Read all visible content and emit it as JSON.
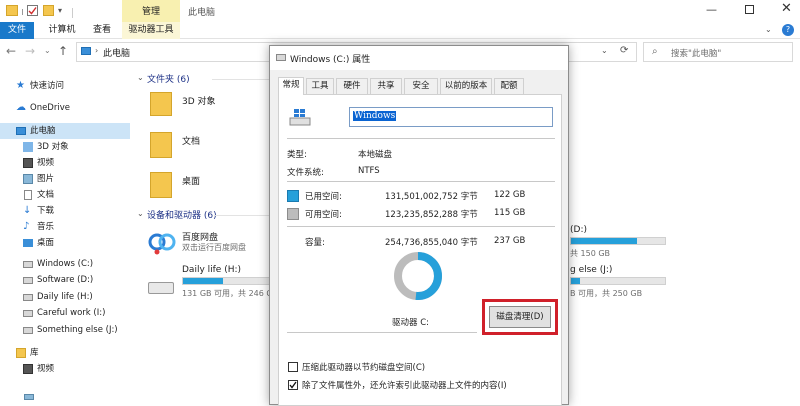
{
  "window": {
    "title": "此电脑",
    "context_tab": "管理",
    "ribbon_tabs": [
      "文件",
      "计算机",
      "查看",
      "驱动器工具"
    ]
  },
  "address": {
    "path": "此电脑",
    "search_placeholder": "搜索\"此电脑\""
  },
  "sidebar": {
    "items": [
      {
        "label": "快速访问",
        "icon": "star-icon"
      },
      {
        "label": "OneDrive",
        "icon": "cloud-icon"
      },
      {
        "label": "此电脑",
        "icon": "computer-icon"
      },
      {
        "label": "3D 对象",
        "icon": "cube-icon"
      },
      {
        "label": "视频",
        "icon": "video-icon"
      },
      {
        "label": "图片",
        "icon": "picture-icon"
      },
      {
        "label": "文档",
        "icon": "document-icon"
      },
      {
        "label": "下载",
        "icon": "download-icon"
      },
      {
        "label": "音乐",
        "icon": "music-icon"
      },
      {
        "label": "桌面",
        "icon": "desktop-icon"
      },
      {
        "label": "Windows (C:)",
        "icon": "drive-icon"
      },
      {
        "label": "Software (D:)",
        "icon": "drive-icon"
      },
      {
        "label": "Daily life (H:)",
        "icon": "drive-icon"
      },
      {
        "label": "Careful work (I:)",
        "icon": "drive-icon"
      },
      {
        "label": "Something else (J:)",
        "icon": "drive-icon"
      },
      {
        "label": "库",
        "icon": "library-icon"
      },
      {
        "label": "视频",
        "icon": "video-icon"
      }
    ]
  },
  "content": {
    "folders_header": "文件夹 (6)",
    "folders": [
      "3D 对象",
      "文档",
      "桌面"
    ],
    "devices_header": "设备和驱动器 (6)",
    "baidu": {
      "name": "百度网盘",
      "sub": "双击运行百度网盘"
    },
    "daily": {
      "name": "Daily life (H:)",
      "sub": "131 GB 可用，共 246 G",
      "used_fraction": 0.47
    },
    "right_d": {
      "name": "(D:)",
      "sub": "共 150 GB",
      "used_fraction": 0.7
    },
    "right_j": {
      "name": "g else (J:)",
      "sub": "B 可用，共 250 GB",
      "used_fraction": 0.1
    }
  },
  "dialog": {
    "title": "Windows (C:) 属性",
    "tabs": [
      "常规",
      "工具",
      "硬件",
      "共享",
      "安全",
      "以前的版本",
      "配额"
    ],
    "name_value": "Windows",
    "type_label": "类型:",
    "type_value": "本地磁盘",
    "fs_label": "文件系统:",
    "fs_value": "NTFS",
    "used_label": "已用空间:",
    "used_bytes": "131,501,002,752 字节",
    "used_gb": "122 GB",
    "free_label": "可用空间:",
    "free_bytes": "123,235,852,288 字节",
    "free_gb": "115 GB",
    "cap_label": "容量:",
    "cap_bytes": "254,736,855,040 字节",
    "cap_gb": "237 GB",
    "drive_label": "驱动器 C:",
    "cleanup_button": "磁盘清理(D)",
    "compress_label": "压缩此驱动器以节约磁盘空间(C)",
    "index_label": "除了文件属性外，还允许索引此驱动器上文件的内容(I)",
    "used_fraction": 0.516,
    "colors": {
      "used": "#26a0da",
      "free": "#bcbcbc",
      "highlight": "#d0202a"
    }
  }
}
